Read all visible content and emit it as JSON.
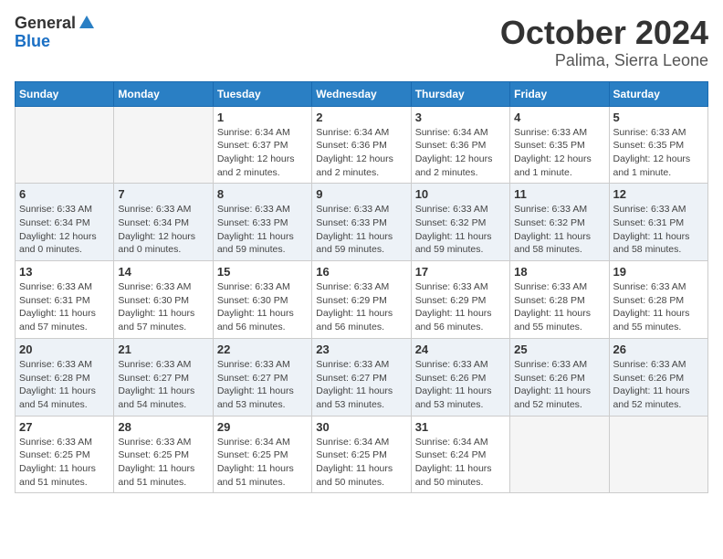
{
  "logo": {
    "general": "General",
    "blue": "Blue"
  },
  "title": {
    "month": "October 2024",
    "location": "Palima, Sierra Leone"
  },
  "headers": [
    "Sunday",
    "Monday",
    "Tuesday",
    "Wednesday",
    "Thursday",
    "Friday",
    "Saturday"
  ],
  "weeks": [
    [
      {
        "day": "",
        "info": ""
      },
      {
        "day": "",
        "info": ""
      },
      {
        "day": "1",
        "info": "Sunrise: 6:34 AM\nSunset: 6:37 PM\nDaylight: 12 hours\nand 2 minutes."
      },
      {
        "day": "2",
        "info": "Sunrise: 6:34 AM\nSunset: 6:36 PM\nDaylight: 12 hours\nand 2 minutes."
      },
      {
        "day": "3",
        "info": "Sunrise: 6:34 AM\nSunset: 6:36 PM\nDaylight: 12 hours\nand 2 minutes."
      },
      {
        "day": "4",
        "info": "Sunrise: 6:33 AM\nSunset: 6:35 PM\nDaylight: 12 hours\nand 1 minute."
      },
      {
        "day": "5",
        "info": "Sunrise: 6:33 AM\nSunset: 6:35 PM\nDaylight: 12 hours\nand 1 minute."
      }
    ],
    [
      {
        "day": "6",
        "info": "Sunrise: 6:33 AM\nSunset: 6:34 PM\nDaylight: 12 hours\nand 0 minutes."
      },
      {
        "day": "7",
        "info": "Sunrise: 6:33 AM\nSunset: 6:34 PM\nDaylight: 12 hours\nand 0 minutes."
      },
      {
        "day": "8",
        "info": "Sunrise: 6:33 AM\nSunset: 6:33 PM\nDaylight: 11 hours\nand 59 minutes."
      },
      {
        "day": "9",
        "info": "Sunrise: 6:33 AM\nSunset: 6:33 PM\nDaylight: 11 hours\nand 59 minutes."
      },
      {
        "day": "10",
        "info": "Sunrise: 6:33 AM\nSunset: 6:32 PM\nDaylight: 11 hours\nand 59 minutes."
      },
      {
        "day": "11",
        "info": "Sunrise: 6:33 AM\nSunset: 6:32 PM\nDaylight: 11 hours\nand 58 minutes."
      },
      {
        "day": "12",
        "info": "Sunrise: 6:33 AM\nSunset: 6:31 PM\nDaylight: 11 hours\nand 58 minutes."
      }
    ],
    [
      {
        "day": "13",
        "info": "Sunrise: 6:33 AM\nSunset: 6:31 PM\nDaylight: 11 hours\nand 57 minutes."
      },
      {
        "day": "14",
        "info": "Sunrise: 6:33 AM\nSunset: 6:30 PM\nDaylight: 11 hours\nand 57 minutes."
      },
      {
        "day": "15",
        "info": "Sunrise: 6:33 AM\nSunset: 6:30 PM\nDaylight: 11 hours\nand 56 minutes."
      },
      {
        "day": "16",
        "info": "Sunrise: 6:33 AM\nSunset: 6:29 PM\nDaylight: 11 hours\nand 56 minutes."
      },
      {
        "day": "17",
        "info": "Sunrise: 6:33 AM\nSunset: 6:29 PM\nDaylight: 11 hours\nand 56 minutes."
      },
      {
        "day": "18",
        "info": "Sunrise: 6:33 AM\nSunset: 6:28 PM\nDaylight: 11 hours\nand 55 minutes."
      },
      {
        "day": "19",
        "info": "Sunrise: 6:33 AM\nSunset: 6:28 PM\nDaylight: 11 hours\nand 55 minutes."
      }
    ],
    [
      {
        "day": "20",
        "info": "Sunrise: 6:33 AM\nSunset: 6:28 PM\nDaylight: 11 hours\nand 54 minutes."
      },
      {
        "day": "21",
        "info": "Sunrise: 6:33 AM\nSunset: 6:27 PM\nDaylight: 11 hours\nand 54 minutes."
      },
      {
        "day": "22",
        "info": "Sunrise: 6:33 AM\nSunset: 6:27 PM\nDaylight: 11 hours\nand 53 minutes."
      },
      {
        "day": "23",
        "info": "Sunrise: 6:33 AM\nSunset: 6:27 PM\nDaylight: 11 hours\nand 53 minutes."
      },
      {
        "day": "24",
        "info": "Sunrise: 6:33 AM\nSunset: 6:26 PM\nDaylight: 11 hours\nand 53 minutes."
      },
      {
        "day": "25",
        "info": "Sunrise: 6:33 AM\nSunset: 6:26 PM\nDaylight: 11 hours\nand 52 minutes."
      },
      {
        "day": "26",
        "info": "Sunrise: 6:33 AM\nSunset: 6:26 PM\nDaylight: 11 hours\nand 52 minutes."
      }
    ],
    [
      {
        "day": "27",
        "info": "Sunrise: 6:33 AM\nSunset: 6:25 PM\nDaylight: 11 hours\nand 51 minutes."
      },
      {
        "day": "28",
        "info": "Sunrise: 6:33 AM\nSunset: 6:25 PM\nDaylight: 11 hours\nand 51 minutes."
      },
      {
        "day": "29",
        "info": "Sunrise: 6:34 AM\nSunset: 6:25 PM\nDaylight: 11 hours\nand 51 minutes."
      },
      {
        "day": "30",
        "info": "Sunrise: 6:34 AM\nSunset: 6:25 PM\nDaylight: 11 hours\nand 50 minutes."
      },
      {
        "day": "31",
        "info": "Sunrise: 6:34 AM\nSunset: 6:24 PM\nDaylight: 11 hours\nand 50 minutes."
      },
      {
        "day": "",
        "info": ""
      },
      {
        "day": "",
        "info": ""
      }
    ]
  ]
}
